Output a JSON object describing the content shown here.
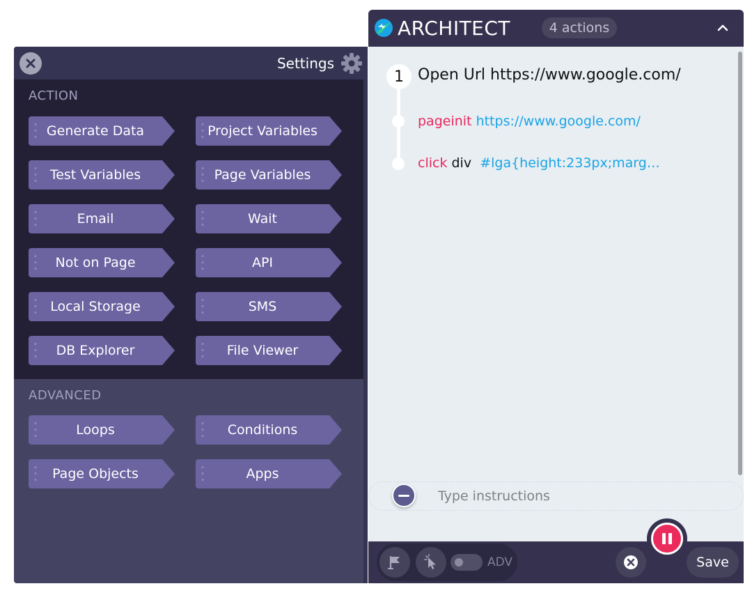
{
  "settings": {
    "title": "Settings",
    "sections": [
      {
        "title": "ACTION",
        "buttons": [
          "Generate Data",
          "Project Variables",
          "Test Variables",
          "Page Variables",
          "Email",
          "Wait",
          "Not on Page",
          "API",
          "Local Storage",
          "SMS",
          "DB Explorer",
          "File Viewer"
        ]
      },
      {
        "title": "ADVANCED",
        "buttons": [
          "Loops",
          "Conditions",
          "Page Objects",
          "Apps"
        ]
      }
    ]
  },
  "architect": {
    "title": "ARCHITECT",
    "actions_count": "4 actions",
    "steps": [
      {
        "number": "1",
        "label": "Open Url https://www.google.com/",
        "sub_actions": [
          {
            "command": "pageinit",
            "target": "",
            "value": "https://www.google.com/"
          },
          {
            "command": "click",
            "target": "div",
            "value": "#lga{height:233px;marg…"
          }
        ]
      }
    ],
    "instructions_placeholder": "Type instructions",
    "footer": {
      "adv_label": "ADV",
      "save_label": "Save"
    }
  },
  "colors": {
    "accent_pink": "#ec2b5d",
    "link_blue": "#1aa4e6",
    "button_purple": "#6c63a1",
    "header_dark": "#35314f"
  },
  "icons": {
    "settings_close": "close-icon",
    "settings_gear": "gear-icon",
    "logo": "architect-logo-icon",
    "collapse": "chevron-up-icon",
    "flag": "flag-icon",
    "pointer": "cursor-pointer-icon",
    "cancel": "close-icon",
    "pause": "pause-icon"
  }
}
